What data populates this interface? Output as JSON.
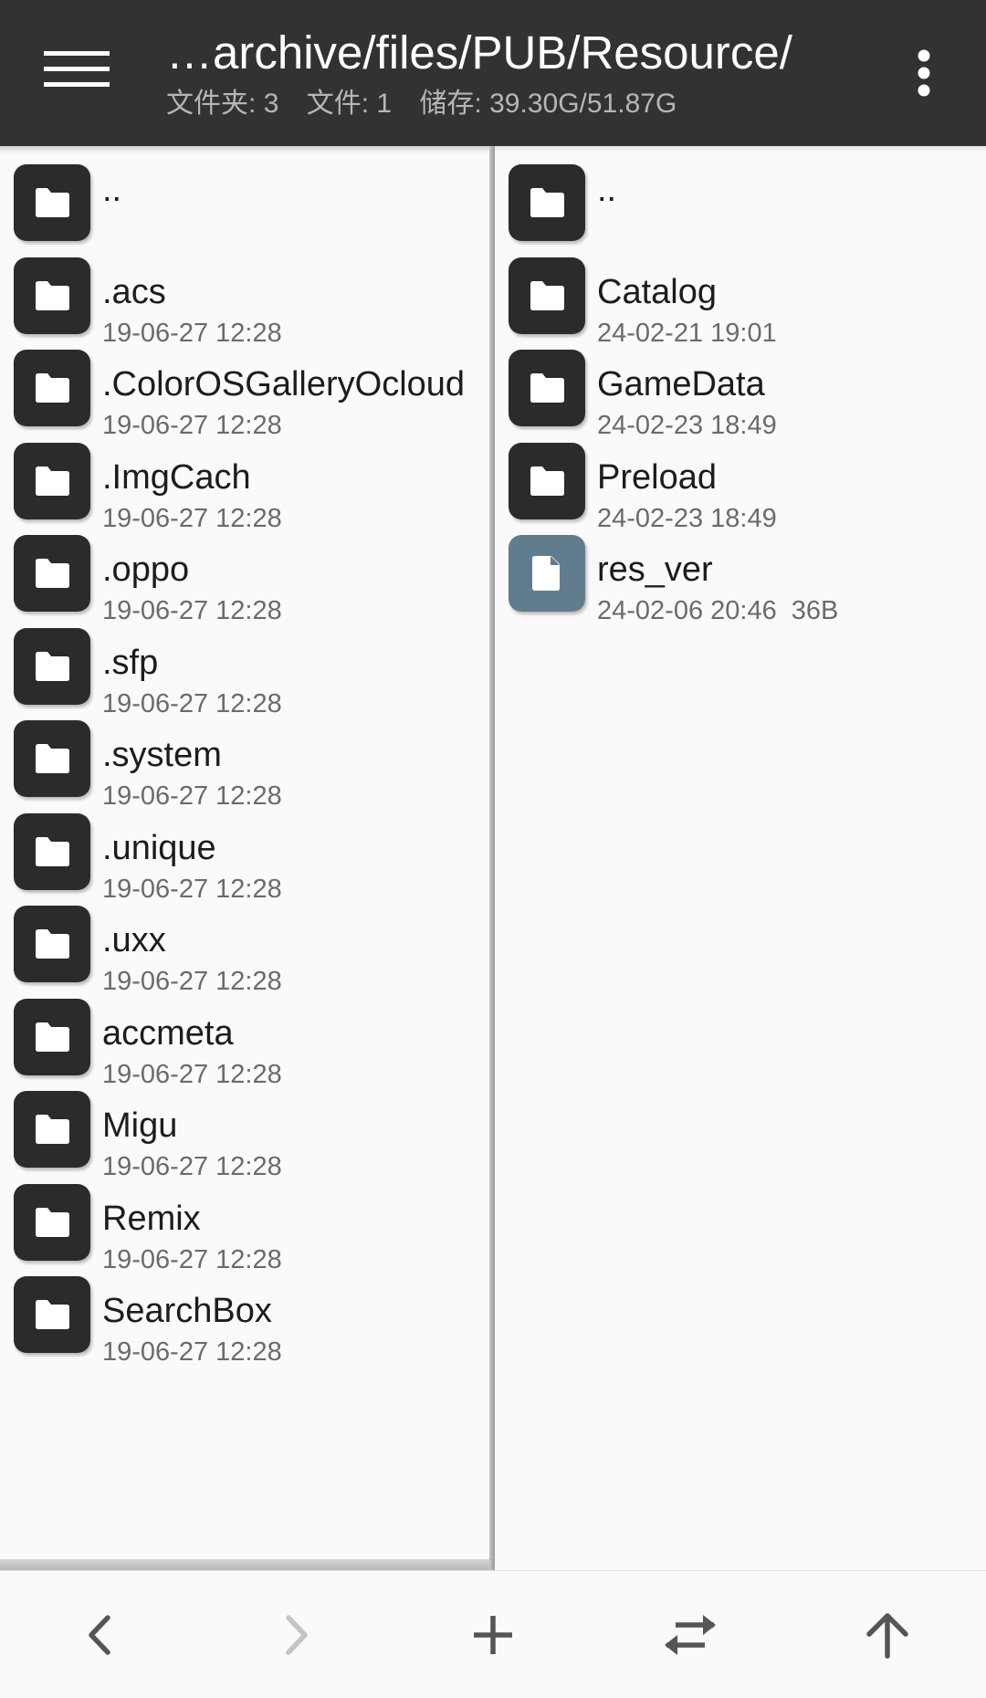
{
  "header": {
    "path": "…archive/files/PUB/Resource/",
    "stats": [
      {
        "label": "文件夹:",
        "value": "3"
      },
      {
        "label": "文件:",
        "value": "1"
      },
      {
        "label": "储存:",
        "value": "39.30G/51.87G"
      }
    ],
    "menu_icon": "hamburger-menu-icon",
    "more_icon": "more-vertical-icon"
  },
  "left_pane": {
    "items": [
      {
        "name": "..",
        "date": "",
        "type": "folder"
      },
      {
        "name": ".acs",
        "date": "19-06-27 12:28",
        "type": "folder"
      },
      {
        "name": ".ColorOSGalleryOcloud",
        "date": "19-06-27 12:28",
        "type": "folder"
      },
      {
        "name": ".ImgCach",
        "date": "19-06-27 12:28",
        "type": "folder"
      },
      {
        "name": ".oppo",
        "date": "19-06-27 12:28",
        "type": "folder"
      },
      {
        "name": ".sfp",
        "date": "19-06-27 12:28",
        "type": "folder"
      },
      {
        "name": ".system",
        "date": "19-06-27 12:28",
        "type": "folder"
      },
      {
        "name": ".unique",
        "date": "19-06-27 12:28",
        "type": "folder"
      },
      {
        "name": ".uxx",
        "date": "19-06-27 12:28",
        "type": "folder"
      },
      {
        "name": "accmeta",
        "date": "19-06-27 12:28",
        "type": "folder"
      },
      {
        "name": "Migu",
        "date": "19-06-27 12:28",
        "type": "folder"
      },
      {
        "name": "Remix",
        "date": "19-06-27 12:28",
        "type": "folder"
      },
      {
        "name": "SearchBox",
        "date": "19-06-27 12:28",
        "type": "folder"
      }
    ]
  },
  "right_pane": {
    "items": [
      {
        "name": "..",
        "date": "",
        "type": "folder"
      },
      {
        "name": "Catalog",
        "date": "24-02-21 19:01",
        "type": "folder"
      },
      {
        "name": "GameData",
        "date": "24-02-23 18:49",
        "type": "folder"
      },
      {
        "name": "Preload",
        "date": "24-02-23 18:49",
        "type": "folder"
      },
      {
        "name": "res_ver",
        "date": "24-02-06 20:46",
        "size": "36B",
        "type": "file"
      }
    ]
  },
  "bottom_bar": {
    "buttons": [
      "back-arrow-icon",
      "forward-arrow-icon",
      "add-icon",
      "swap-panes-icon",
      "up-arrow-icon"
    ]
  },
  "colors": {
    "header_bg": "#323232",
    "folder_icon_bg": "#2b2b2b",
    "file_icon_bg": "#617d8d",
    "page_bg": "#fcf9fb"
  }
}
